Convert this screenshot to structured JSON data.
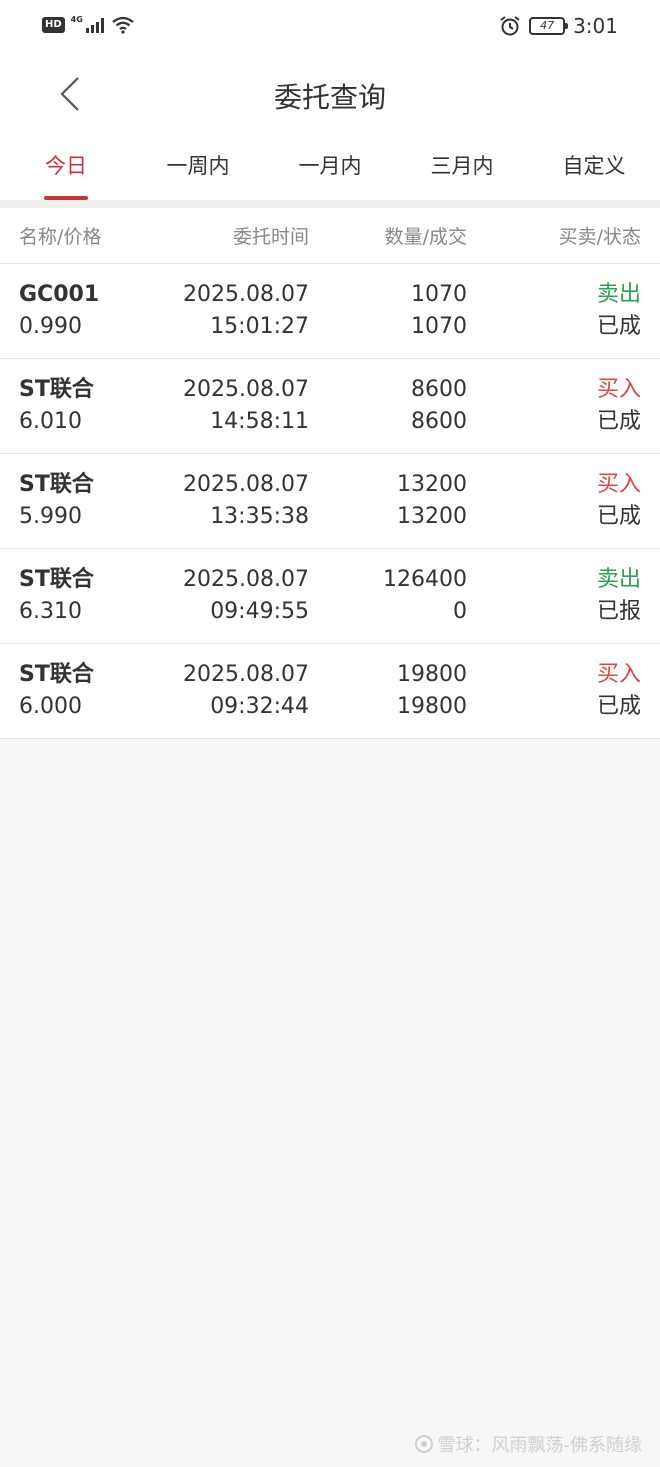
{
  "status_bar": {
    "hd": "HD",
    "network": "4G",
    "battery": "47",
    "time": "3:01"
  },
  "nav": {
    "title": "委托查询"
  },
  "tabs": [
    {
      "label": "今日"
    },
    {
      "label": "一周内"
    },
    {
      "label": "一月内"
    },
    {
      "label": "三月内"
    },
    {
      "label": "自定义"
    }
  ],
  "table": {
    "headers": {
      "name_price": "名称/价格",
      "time": "委托时间",
      "qty": "数量/成交",
      "side_status": "买卖/状态"
    },
    "rows": [
      {
        "name": "GC001",
        "price": "0.990",
        "date": "2025.08.07",
        "time": "15:01:27",
        "qty": "1070",
        "filled": "1070",
        "side": "卖出",
        "status": "已成"
      },
      {
        "name": "ST联合",
        "price": "6.010",
        "date": "2025.08.07",
        "time": "14:58:11",
        "qty": "8600",
        "filled": "8600",
        "side": "买入",
        "status": "已成"
      },
      {
        "name": "ST联合",
        "price": "5.990",
        "date": "2025.08.07",
        "time": "13:35:38",
        "qty": "13200",
        "filled": "13200",
        "side": "买入",
        "status": "已成"
      },
      {
        "name": "ST联合",
        "price": "6.310",
        "date": "2025.08.07",
        "time": "09:49:55",
        "qty": "126400",
        "filled": "0",
        "side": "卖出",
        "status": "已报"
      },
      {
        "name": "ST联合",
        "price": "6.000",
        "date": "2025.08.07",
        "time": "09:32:44",
        "qty": "19800",
        "filled": "19800",
        "side": "买入",
        "status": "已成"
      }
    ]
  },
  "watermark": {
    "text": "雪球：风雨飘荡-佛系随缘"
  },
  "colors": {
    "accent_red": "#c8323a",
    "buy_red": "#d9464c",
    "sell_green": "#2aa150"
  }
}
